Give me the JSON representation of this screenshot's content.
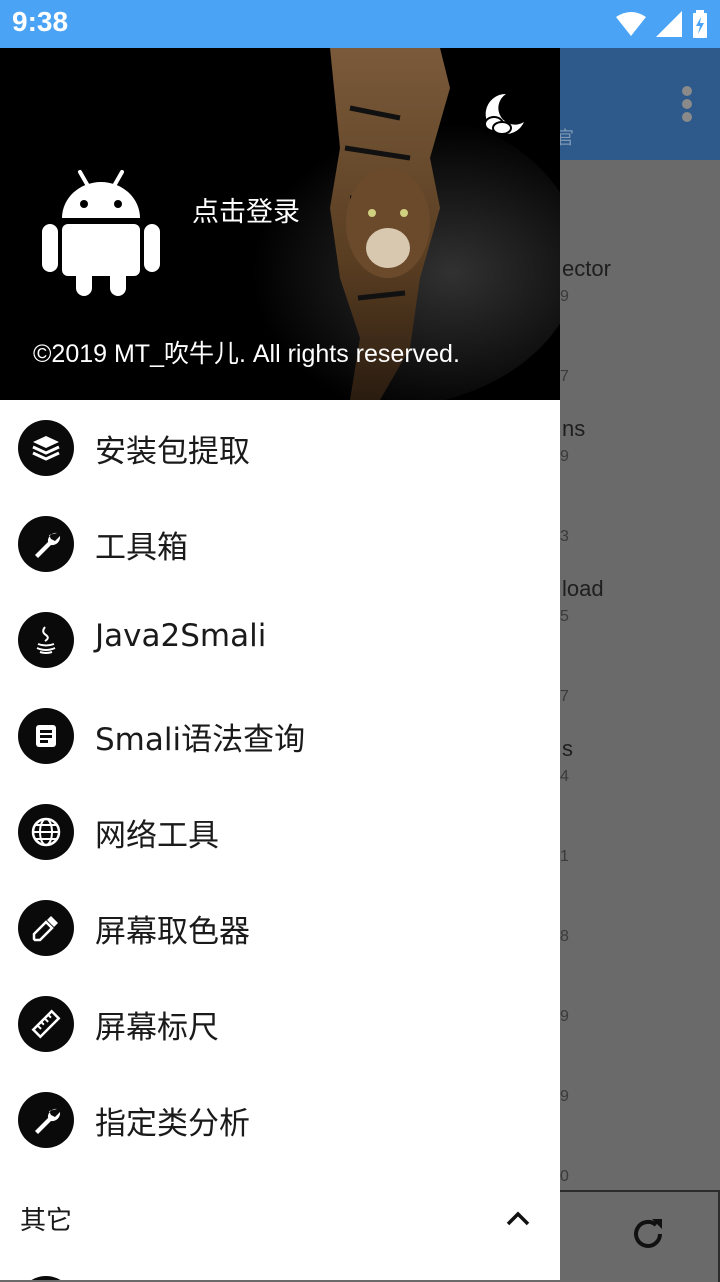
{
  "status_bar": {
    "time": "9:38"
  },
  "drawer": {
    "login_text": "点击登录",
    "copyright": "©2019 MT_吹牛儿. All rights reserved.",
    "menu_items": [
      {
        "label": "安装包提取",
        "icon": "layers-icon"
      },
      {
        "label": "工具箱",
        "icon": "wrench-icon"
      },
      {
        "label": "Java2Smali",
        "icon": "java-icon"
      },
      {
        "label": "Smali语法查询",
        "icon": "smali-icon"
      },
      {
        "label": "网络工具",
        "icon": "globe-icon"
      },
      {
        "label": "屏幕取色器",
        "icon": "eyedropper-icon"
      },
      {
        "label": "屏幕标尺",
        "icon": "ruler-icon"
      },
      {
        "label": "指定类分析",
        "icon": "wrench-icon"
      }
    ],
    "section": {
      "label": "其它",
      "expanded": true
    }
  },
  "background_list": {
    "fragments": [
      {
        "title": "ector",
        "sub": "9"
      },
      {
        "title": "",
        "sub": "7"
      },
      {
        "title": "ns",
        "sub": "9"
      },
      {
        "title": "",
        "sub": "3"
      },
      {
        "title": "load",
        "sub": "5"
      },
      {
        "title": "",
        "sub": "7"
      },
      {
        "title": "s",
        "sub": "4"
      },
      {
        "title": "",
        "sub": "1"
      },
      {
        "title": "",
        "sub": "8"
      },
      {
        "title": "",
        "sub": "9"
      },
      {
        "title": "",
        "sub": "9"
      },
      {
        "title": "",
        "sub": "0"
      }
    ],
    "toolbar_fragment": "官"
  },
  "colors": {
    "status_bar": "#4aa3f5",
    "toolbar": "#2d5a8a",
    "scrim": "#6a6a6a",
    "icon_bg": "#0a0a0a"
  }
}
